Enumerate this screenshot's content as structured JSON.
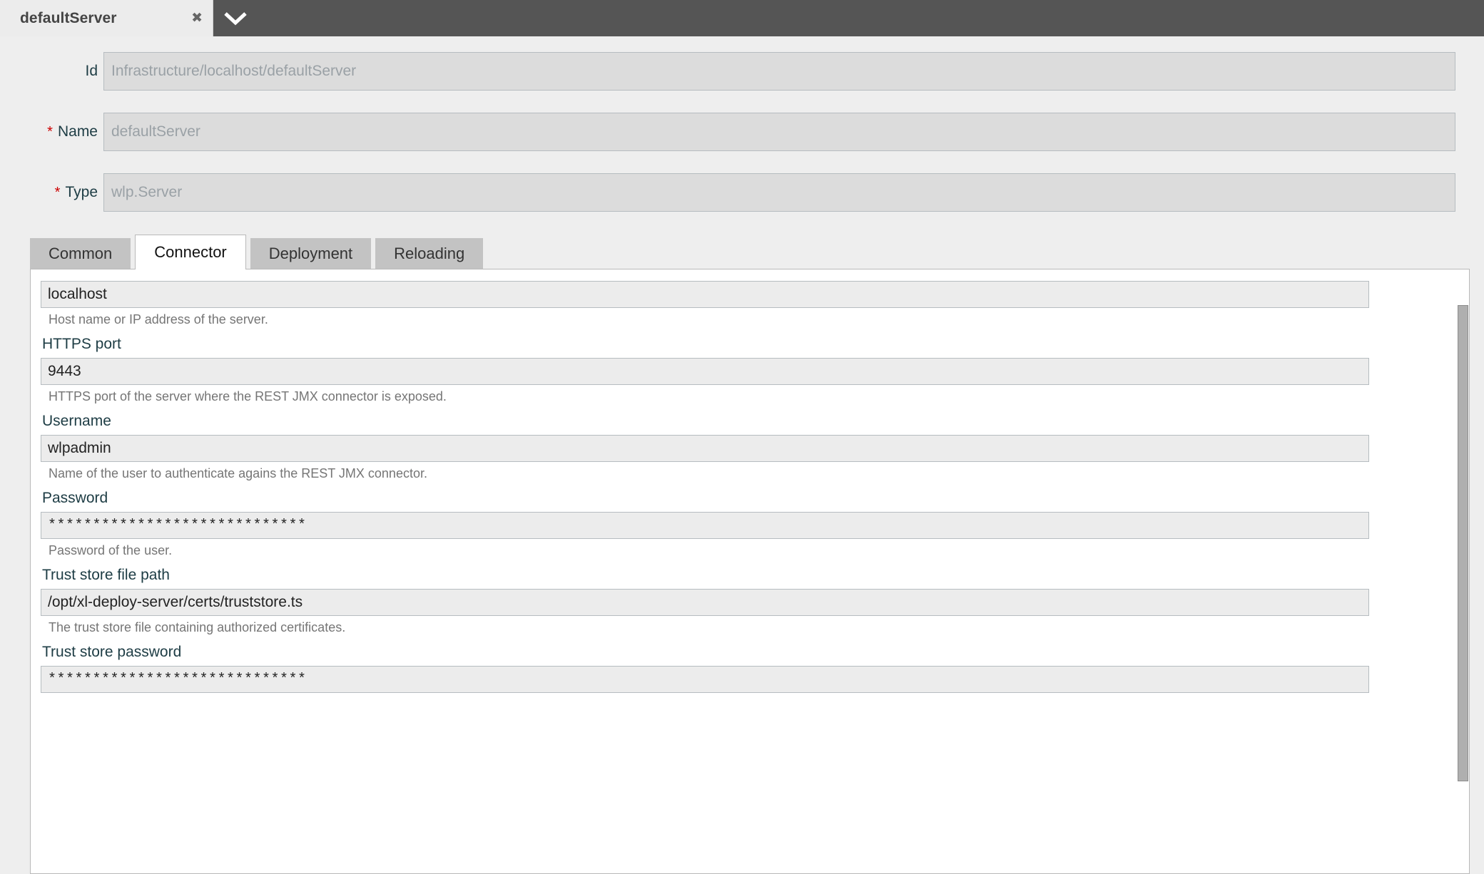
{
  "window": {
    "tab_label": "defaultServer",
    "close_icon": "close-icon",
    "dropdown_icon": "chevron-down-icon"
  },
  "top_form": {
    "rows": [
      {
        "label": "Id",
        "required": false,
        "value": "Infrastructure/localhost/defaultServer"
      },
      {
        "label": "Name",
        "required": true,
        "value": "defaultServer"
      },
      {
        "label": "Type",
        "required": true,
        "value": "wlp.Server"
      }
    ],
    "required_marker": "*"
  },
  "tabs": [
    {
      "label": "Common",
      "active": false
    },
    {
      "label": "Connector",
      "active": true
    },
    {
      "label": "Deployment",
      "active": false
    },
    {
      "label": "Reloading",
      "active": false
    }
  ],
  "connector": {
    "fields": [
      {
        "label": "",
        "value": "localhost",
        "help": "Host name or IP address of the server.",
        "masked": false
      },
      {
        "label": "HTTPS port",
        "value": "9443",
        "help": "HTTPS port of the server where the REST JMX connector is exposed.",
        "masked": false
      },
      {
        "label": "Username",
        "value": "wlpadmin",
        "help": "Name of the user to authenticate agains the REST JMX connector.",
        "masked": false
      },
      {
        "label": "Password",
        "value": "*****************************",
        "help": "Password of the user.",
        "masked": true
      },
      {
        "label": "Trust store file path",
        "value": "/opt/xl-deploy-server/certs/truststore.ts",
        "help": "The trust store file containing authorized certificates.",
        "masked": false
      },
      {
        "label": "Trust store password",
        "value": "*****************************",
        "help": "",
        "masked": true
      }
    ]
  },
  "colors": {
    "chrome_bar": "#555555",
    "page_bg": "#eeeeee",
    "label_text": "#1d3c44",
    "required_star": "#cc0000",
    "tab_inactive": "#c3c3c3",
    "tab_active": "#ffffff",
    "input_bg": "#ececec",
    "disabled_input_bg": "#dcdcdc",
    "help_text": "#757575",
    "scrollbar_thumb": "#afafaf"
  }
}
